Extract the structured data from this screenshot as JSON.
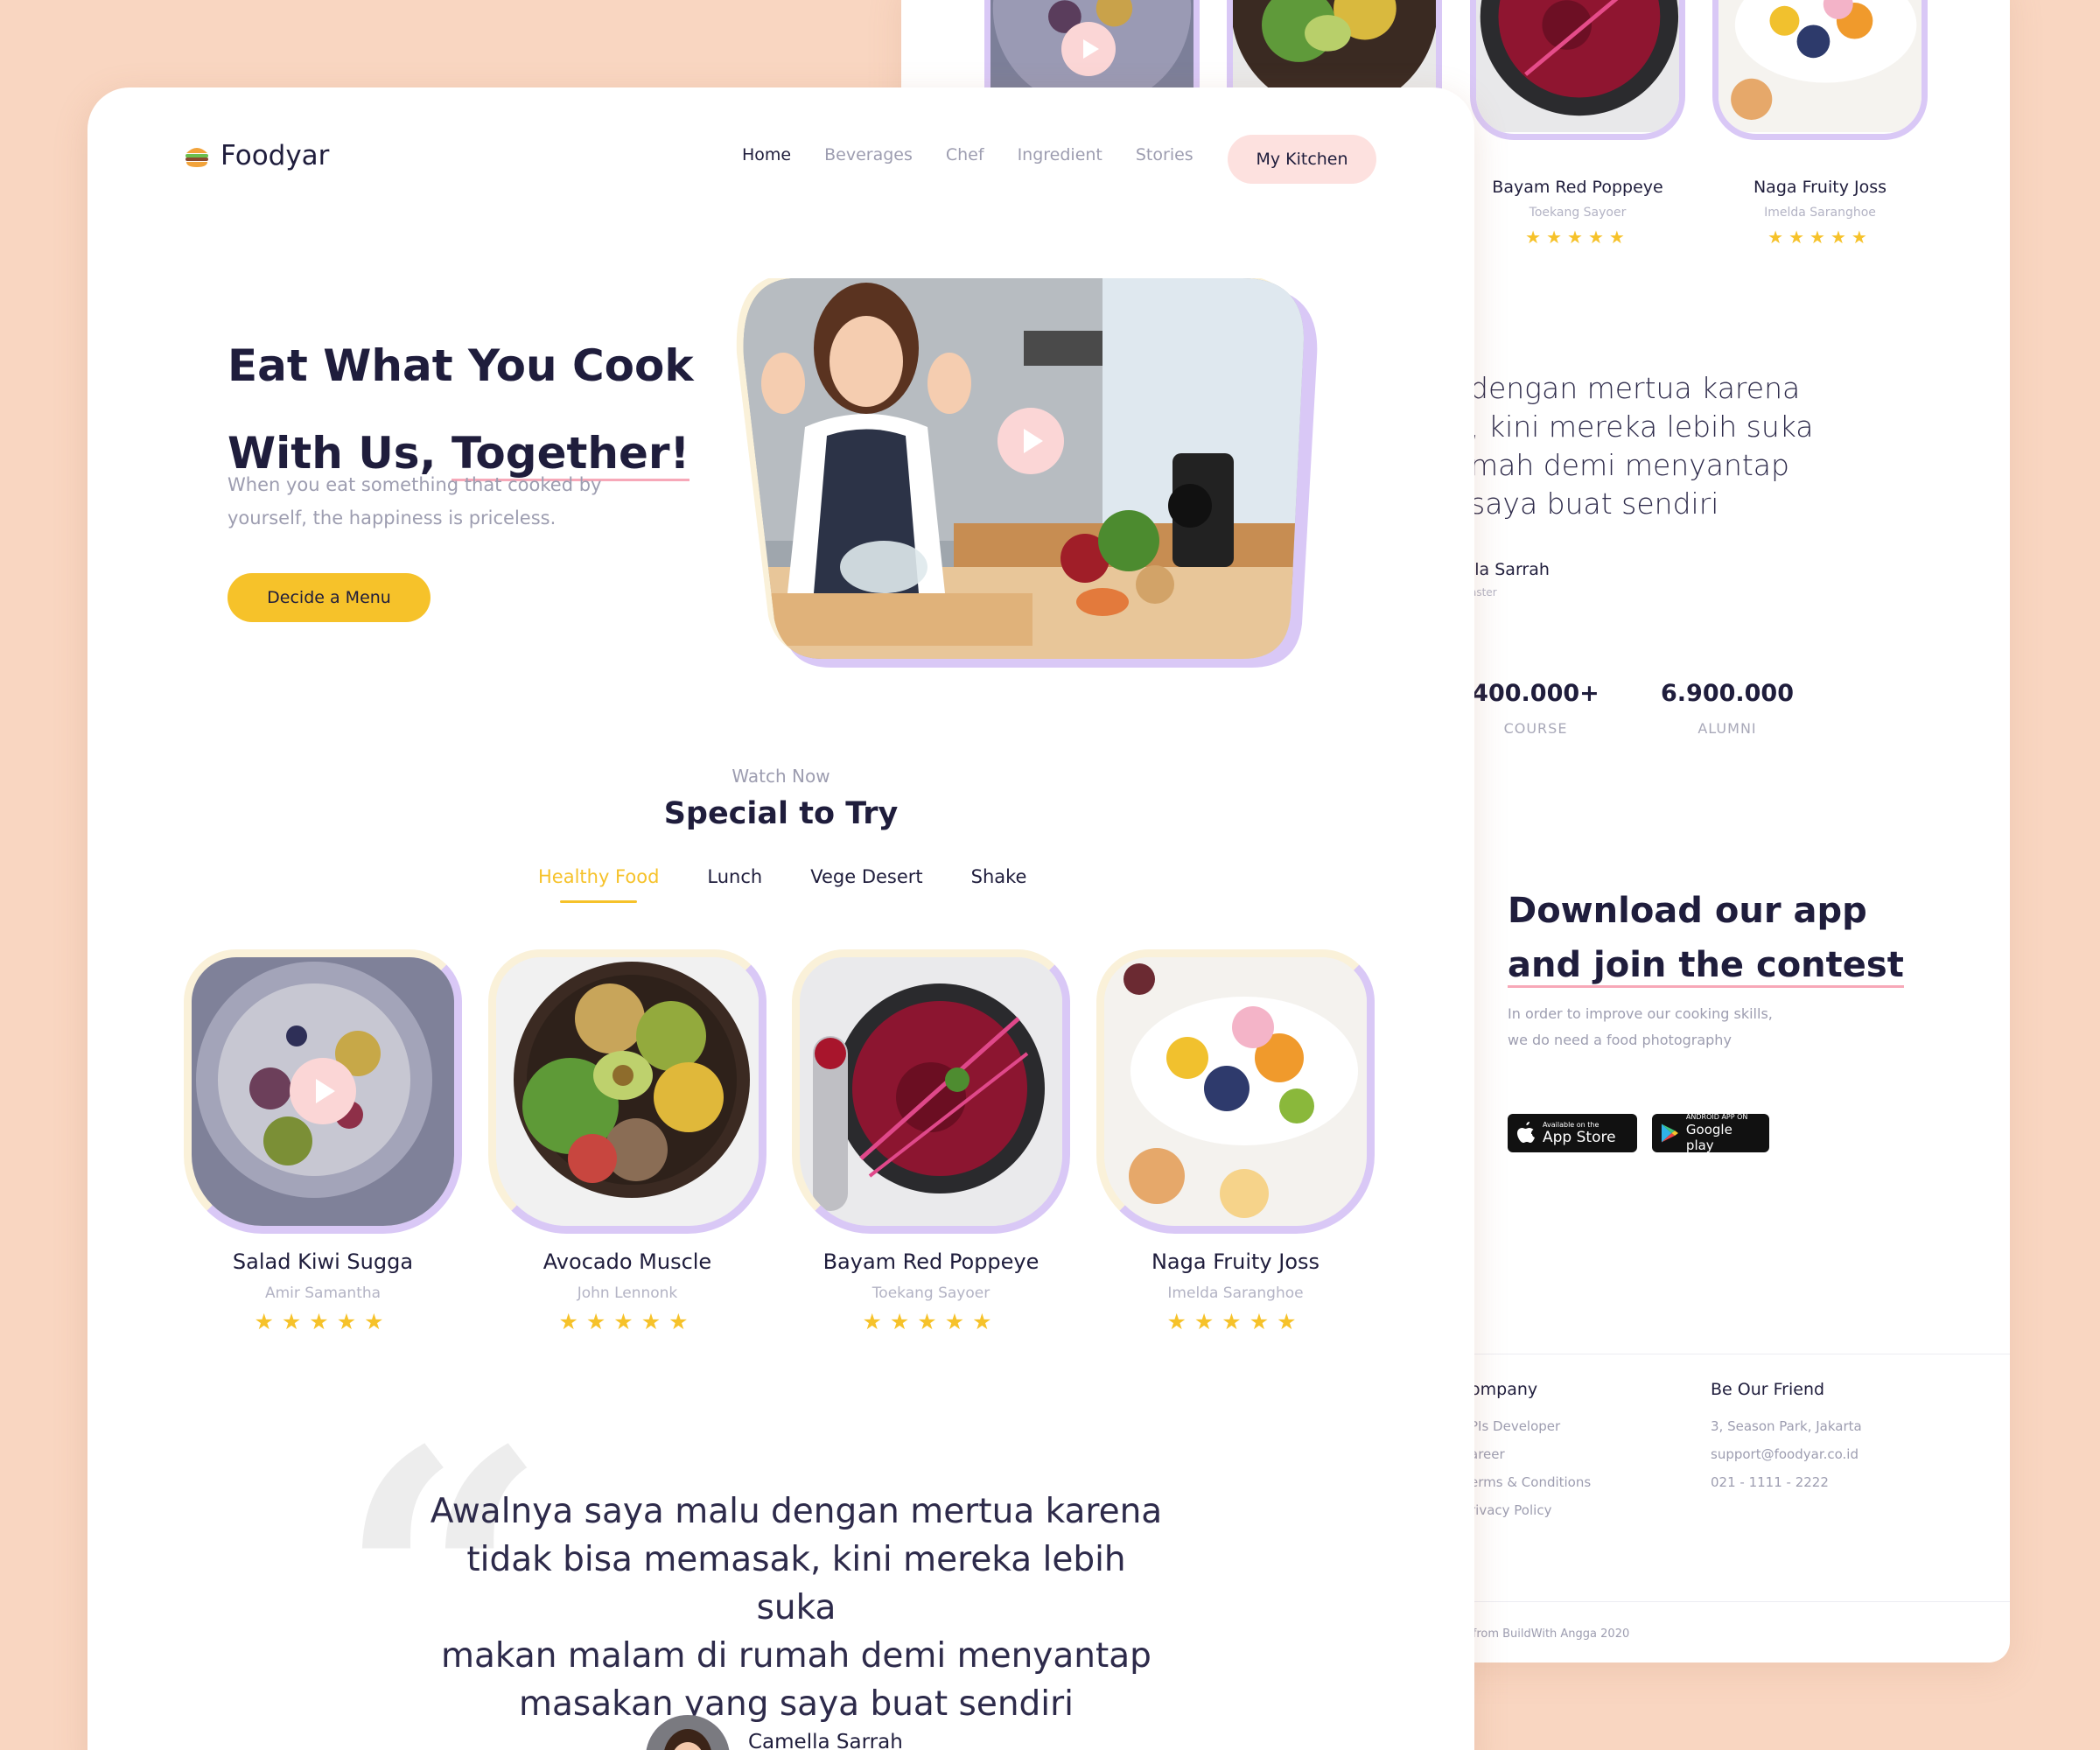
{
  "brand": {
    "name": "Foodyar",
    "icon": "burger-icon"
  },
  "nav": {
    "items": [
      "Home",
      "Beverages",
      "Chef",
      "Ingredient",
      "Stories"
    ],
    "active": "Home",
    "cta": "My Kitchen"
  },
  "hero": {
    "title_line1": "Eat What You Cook",
    "title_line2_a": "With Us, ",
    "title_line2_b": "Together!",
    "description": "When you eat something that cooked by yourself, the happiness is priceless.",
    "button": "Decide a Menu"
  },
  "special": {
    "kicker": "Watch Now",
    "title": "Special to Try",
    "tabs": [
      "Healthy Food",
      "Lunch",
      "Vege Desert",
      "Shake"
    ],
    "active_tab": "Healthy Food",
    "cards": [
      {
        "title": "Salad Kiwi Sugga",
        "author": "Amir Samantha",
        "stars": "★★★★★",
        "rating": 5
      },
      {
        "title": "Avocado Muscle",
        "author": "John Lennonk",
        "stars": "★★★★★",
        "rating": 5
      },
      {
        "title": "Bayam Red Poppeye",
        "author": "Toekang Sayoer",
        "stars": "★★★★★",
        "rating": 5
      },
      {
        "title": "Naga Fruity Joss",
        "author": "Imelda Saranghoe",
        "stars": "★★★★★",
        "rating": 5
      }
    ]
  },
  "testimonial": {
    "quote": "Awalnya saya malu dengan mertua karena\ntidak bisa memasak, kini mereka lebih suka\nmakan malam di rumah demi menyantap\nmasakan yang saya buat sendiri",
    "name": "Camella Sarrah"
  },
  "back": {
    "cards": [
      {
        "title": "Bayam Red Poppeye",
        "author": "Toekang Sayoer",
        "stars": "★★★★★"
      },
      {
        "title": "Naga Fruity Joss",
        "author": "Imelda Saranghoe",
        "stars": "★★★★★"
      }
    ],
    "quote_fragment": "dengan mertua karena\n, kini mereka lebih suka\nmah demi menyantap\n saya buat sendiri",
    "name_fragment": "lla Sarrah",
    "role_fragment": "aster",
    "stats": [
      {
        "value": "400.000+",
        "label": "COURSE"
      },
      {
        "value": "6.900.000",
        "label": "ALUMNI"
      }
    ],
    "download": {
      "title_line1": "Download our app",
      "title_line2": "and join the contest",
      "description": "In order to improve our cooking skills, we do need a food photography",
      "appstore_small": "Available on the",
      "appstore_large": "App Store",
      "google_small": "ANDROID APP ON",
      "google_large": "Google play"
    },
    "footer": {
      "company_title": "ompany",
      "company_items": [
        "PIs Developer",
        "areer",
        "erms & Conditions",
        "rivacy Policy"
      ],
      "friend_title": "Be Our Friend",
      "friend_items": [
        "3, Season Park, Jakarta",
        "support@foodyar.co.id",
        "021 - 1111 - 2222"
      ],
      "copyright": "l from BuildWith Angga 2020"
    }
  },
  "colors": {
    "background": "#f9d6c1",
    "accent_yellow": "#f6c22a",
    "accent_pink": "#fde1df",
    "frame_purple": "#d9c8f6",
    "text_dark": "#1f1d3c",
    "text_muted": "#9d9db0"
  }
}
